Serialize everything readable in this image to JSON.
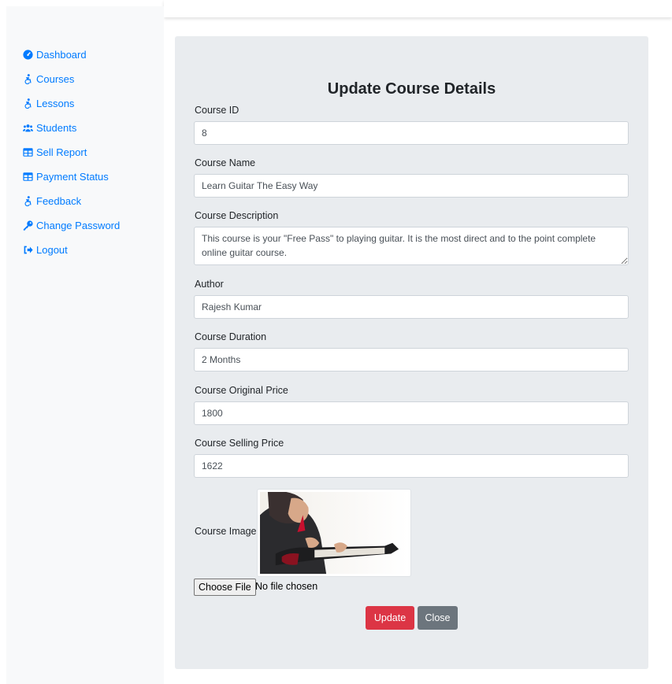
{
  "sidebar": {
    "items": [
      {
        "label": "Dashboard",
        "icon": "tachometer-icon"
      },
      {
        "label": "Courses",
        "icon": "accessible-icon"
      },
      {
        "label": "Lessons",
        "icon": "accessible-icon"
      },
      {
        "label": "Students",
        "icon": "users-icon"
      },
      {
        "label": "Sell Report",
        "icon": "table-icon"
      },
      {
        "label": "Payment Status",
        "icon": "table-icon"
      },
      {
        "label": "Feedback",
        "icon": "accessible-icon"
      },
      {
        "label": "Change Password",
        "icon": "key-icon"
      },
      {
        "label": "Logout",
        "icon": "sign-out-icon"
      }
    ]
  },
  "form": {
    "title": "Update Course Details",
    "course_id": {
      "label": "Course ID",
      "value": "8"
    },
    "course_name": {
      "label": "Course Name",
      "value": "Learn Guitar The Easy Way"
    },
    "course_desc": {
      "label": "Course Description",
      "value": "This course is your \"Free Pass\" to playing guitar. It is the most direct and to the point complete online guitar course."
    },
    "author": {
      "label": "Author",
      "value": "Rajesh Kumar"
    },
    "duration": {
      "label": "Course Duration",
      "value": "2 Months"
    },
    "original_price": {
      "label": "Course Original Price",
      "value": "1800"
    },
    "selling_price": {
      "label": "Course Selling Price",
      "value": "1622"
    },
    "image_label": "Course Image",
    "file_button": "Choose File",
    "file_status": "No file chosen",
    "update_button": "Update",
    "close_button": "Close"
  },
  "colors": {
    "link": "#007bff",
    "panel": "#e9ecef",
    "update": "#dc3545",
    "close": "#6c757d"
  }
}
